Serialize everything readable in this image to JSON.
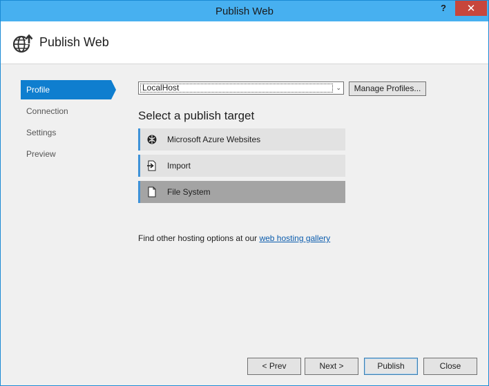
{
  "window": {
    "title": "Publish Web",
    "help_glyph": "?",
    "close_glyph": "✕"
  },
  "header": {
    "title": "Publish Web"
  },
  "nav": {
    "items": [
      {
        "label": "Profile",
        "active": true
      },
      {
        "label": "Connection",
        "active": false
      },
      {
        "label": "Settings",
        "active": false
      },
      {
        "label": "Preview",
        "active": false
      }
    ]
  },
  "profile": {
    "selected_value": "LocalHost",
    "manage_label": "Manage Profiles..."
  },
  "targets": {
    "title": "Select a publish target",
    "items": [
      {
        "label": "Microsoft Azure Websites",
        "icon": "azure-icon",
        "selected": false
      },
      {
        "label": "Import",
        "icon": "import-icon",
        "selected": false
      },
      {
        "label": "File System",
        "icon": "file-icon",
        "selected": true
      }
    ]
  },
  "hosting": {
    "text": "Find other hosting options at our ",
    "link_text": "web hosting gallery"
  },
  "footer": {
    "prev_label": "< Prev",
    "next_label": "Next >",
    "publish_label": "Publish",
    "close_label": "Close"
  },
  "colors": {
    "titlebar": "#47b0f0",
    "accent": "#0f7ecf",
    "close_button": "#c7463c"
  }
}
